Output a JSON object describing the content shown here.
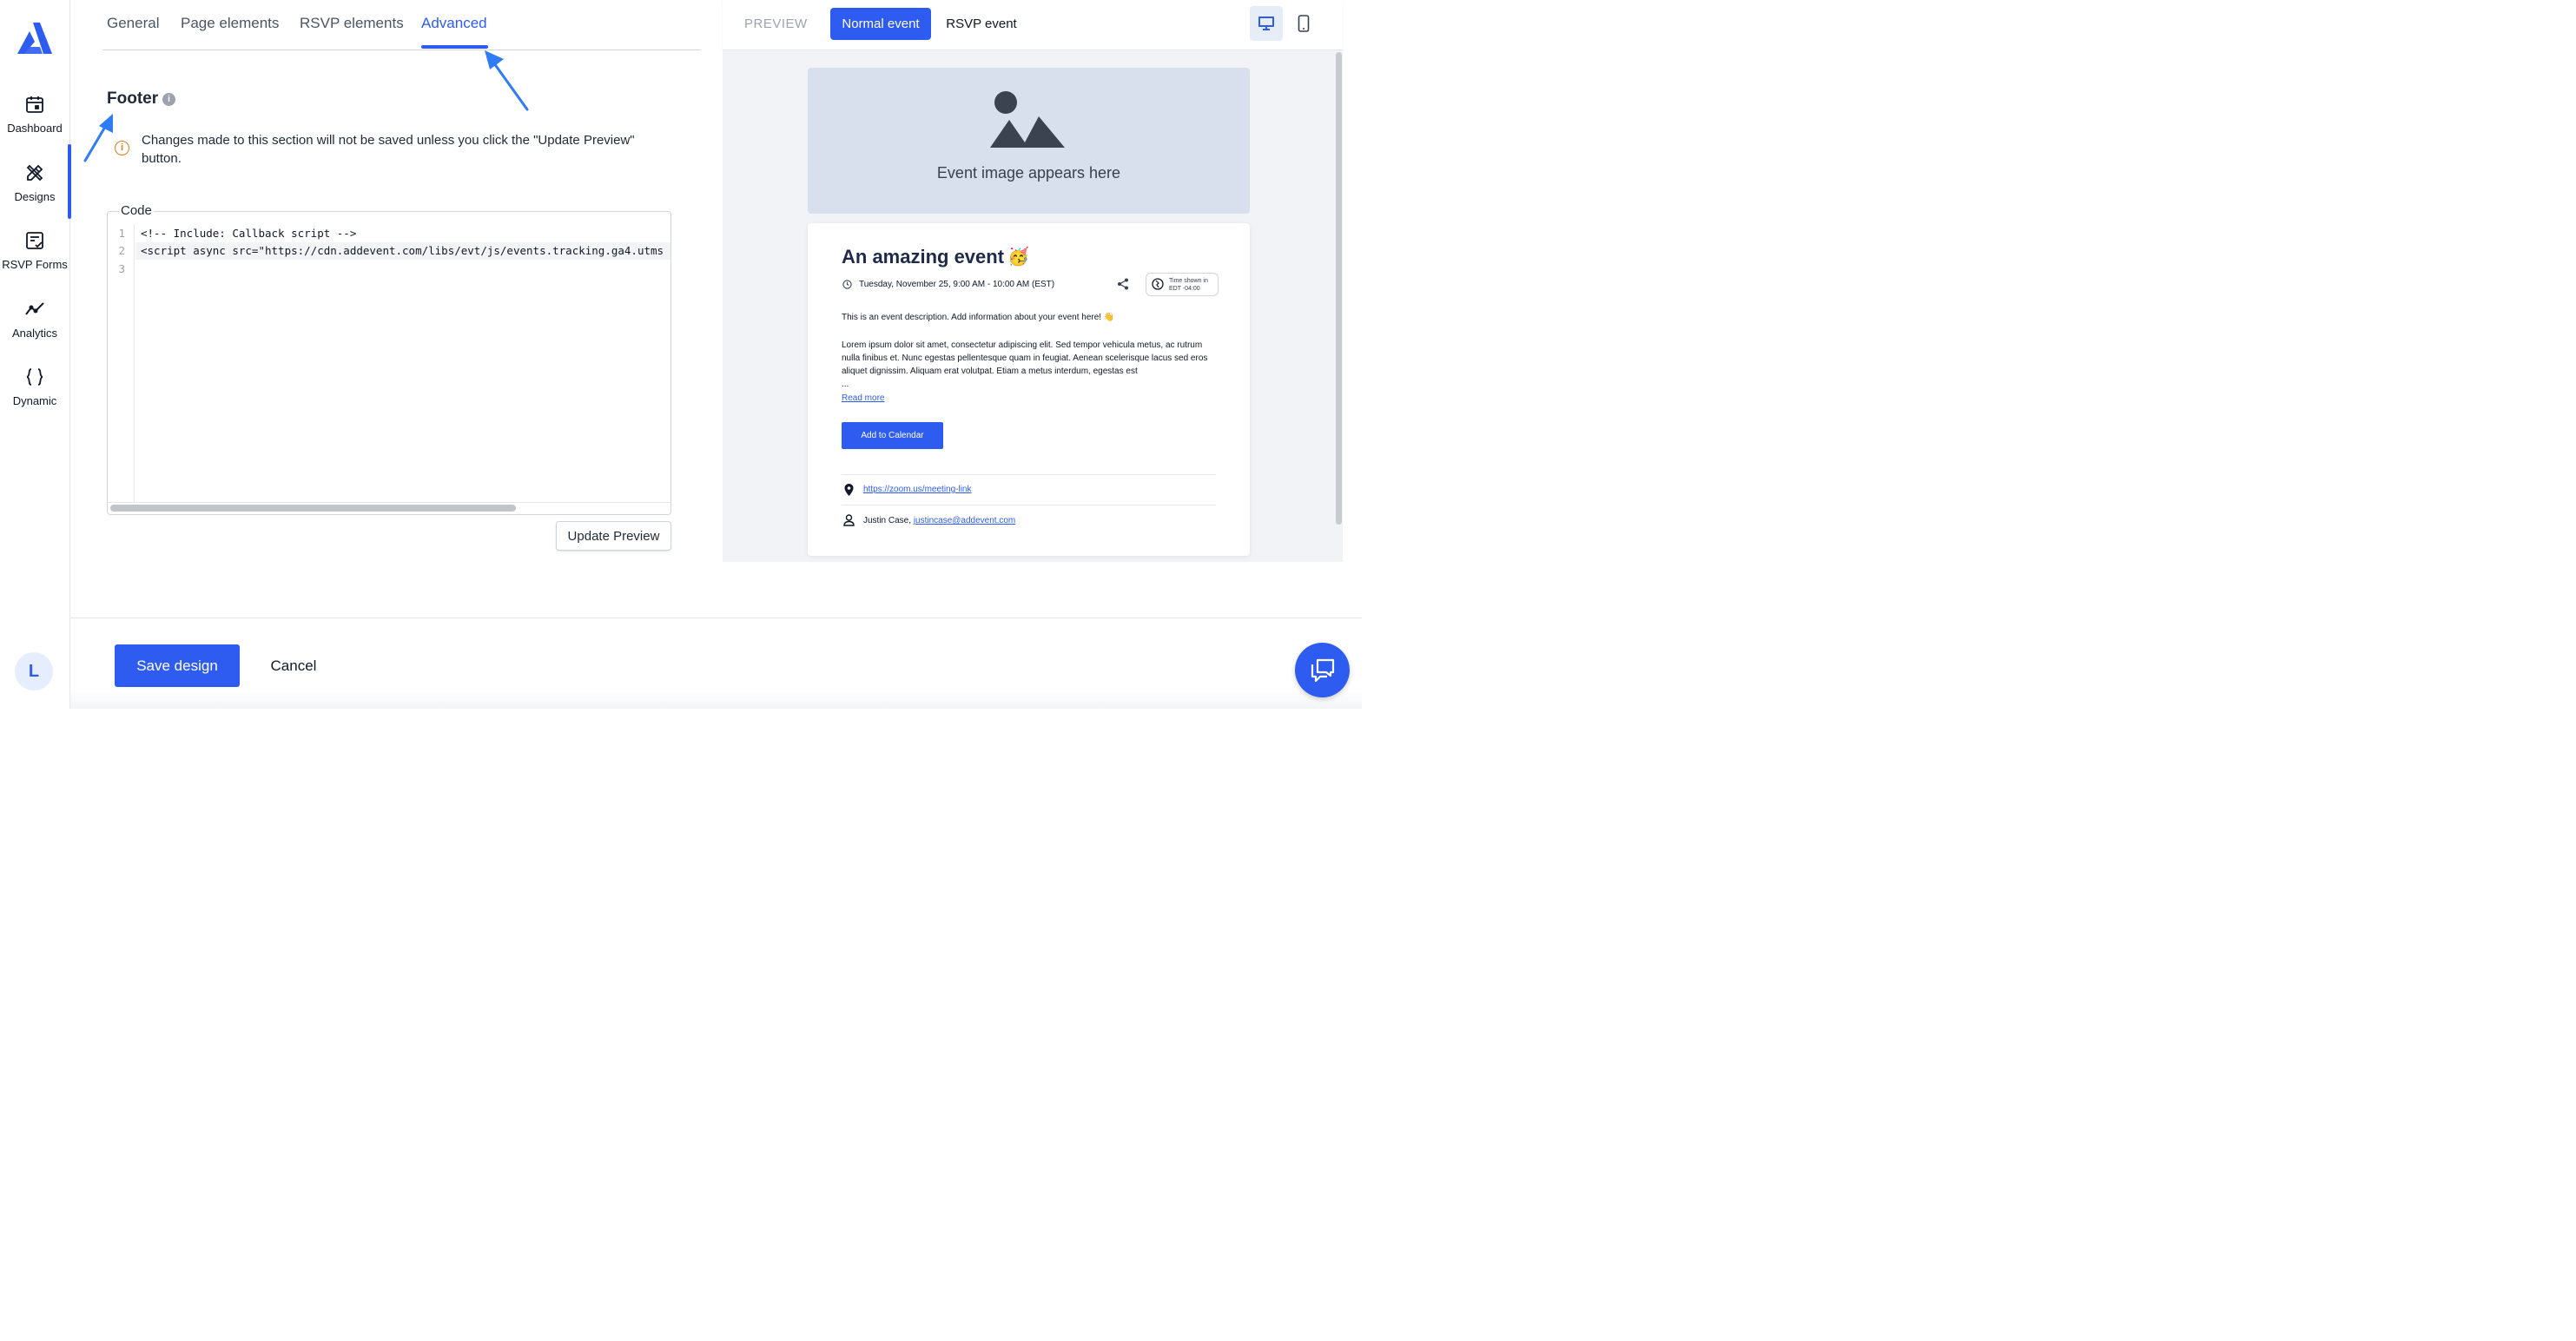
{
  "sidebar": {
    "items": [
      {
        "label": "Dashboard",
        "icon": "calendar-icon"
      },
      {
        "label": "Designs",
        "icon": "pencil-ruler-icon"
      },
      {
        "label": "RSVP Forms",
        "icon": "form-check-icon"
      },
      {
        "label": "Analytics",
        "icon": "trend-line-icon"
      },
      {
        "label": "Dynamic",
        "icon": "braces-icon"
      }
    ],
    "active_item": "Designs",
    "avatar_initial": "L"
  },
  "tabs": {
    "items": [
      "General",
      "Page elements",
      "RSVP elements",
      "Advanced"
    ],
    "active": "Advanced"
  },
  "footer_section": {
    "title": "Footer",
    "info_icon": "info-icon",
    "notice": "Changes made to this section will not be saved unless you click the \"Update Preview\" button.",
    "code_label": "Code",
    "line_numbers": [
      "1",
      "2",
      "3"
    ],
    "code_lines": [
      "<!-- Include: Callback script -->",
      "<script async src=\"https://cdn.addevent.com/libs/evt/js/events.tracking.ga4.utms",
      ""
    ],
    "update_button": "Update Preview"
  },
  "preview": {
    "label": "PREVIEW",
    "toggle_normal": "Normal event",
    "toggle_rsvp": "RSVP event",
    "active_toggle": "Normal event",
    "device_icons": [
      "desktop-icon",
      "mobile-icon"
    ],
    "image_placeholder": "Event image appears here",
    "event": {
      "title": "An amazing event",
      "emoji": "🥳",
      "date": "Tuesday, November 25, 9:00 AM - 10:00 AM (EST)",
      "tz_line1": "Time shown in",
      "tz_line2": "EDT -04:00",
      "description_intro": "This is an event description. Add information about your event here! 👋",
      "description_body": "Lorem ipsum dolor sit amet, consectetur adipiscing elit. Sed tempor vehicula metus, ac rutrum nulla finibus et. Nunc egestas pellentesque quam in feugiat. Aenean scelerisque lacus sed eros aliquet dignissim. Aliquam erat volutpat. Etiam a metus interdum, egestas est",
      "ellipsis": "...",
      "read_more": "Read more",
      "calendar_button": "Add to Calendar",
      "location_link": "https://zoom.us/meeting-link",
      "organizer_name": "Justin Case,",
      "organizer_email": "justincase@addevent.com"
    }
  },
  "actions": {
    "save": "Save design",
    "cancel": "Cancel"
  },
  "colors": {
    "accent": "#2e5cf0",
    "warning": "#e07b1a",
    "placeholder_bg": "#d7e0ec",
    "preview_bg": "#f1f3f6"
  }
}
